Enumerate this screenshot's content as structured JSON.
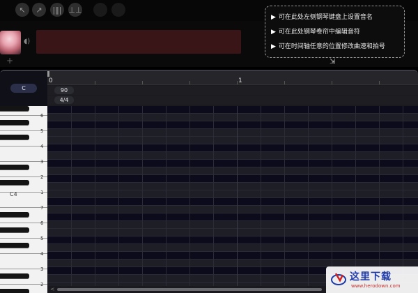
{
  "toolbar": {
    "buttons": [
      {
        "name": "select-tool-button",
        "glyph": "↖"
      },
      {
        "name": "pencil-tool-button",
        "glyph": "↗"
      },
      {
        "name": "mixer-button",
        "glyph": "|‖|"
      },
      {
        "name": "equalizer-button",
        "glyph": "⊥⊥"
      },
      {
        "name": "undo-button",
        "glyph": ""
      },
      {
        "name": "redo-button",
        "glyph": ""
      }
    ]
  },
  "track": {
    "add_label": "+",
    "icon": "speaker-icon",
    "clip_color": "#3a1517"
  },
  "tooltip": {
    "lines": [
      "可在此处左侧钢琴键盘上设置音名",
      "可在此处钢琴卷帘中编辑音符",
      "可在时间轴任意的位置修改曲速和拍号"
    ],
    "bullet": "▶"
  },
  "piano_roll": {
    "key_badge": "C",
    "ruler": {
      "start": "0",
      "bar1": "1"
    },
    "tempo": "90",
    "time_signature": "4/4",
    "c4_label": "C4",
    "key_numbers": [
      "6",
      "5",
      "4",
      "3",
      "2",
      "1",
      "7",
      "6",
      "5",
      "4",
      "3",
      "2"
    ],
    "scroll_arrow": "<"
  },
  "watermark": {
    "title": "这里下载",
    "url": "www.herodown.com"
  },
  "colors": {
    "background": "#000000",
    "grid_black_row": "#0b0b1c",
    "grid_white_row": "#1e1e26",
    "tooltip_border": "#9a9a9a"
  }
}
